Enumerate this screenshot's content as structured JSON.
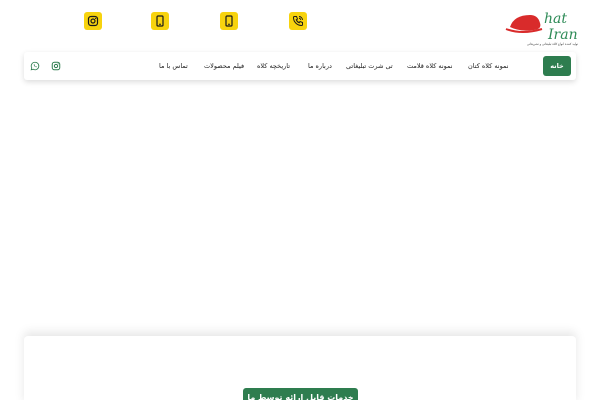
{
  "colors": {
    "brand_green": "#2e7d4f",
    "icon_yellow": "#f7d30e",
    "icon_dark": "#1a1a1a",
    "logo_red": "#d92b2b",
    "logo_green": "#2e8b57"
  },
  "header": {
    "logo_text": "hat iran",
    "logo_tagline": "تولید کننده انواع کلاه تبلیغاتی و تشریفاتی",
    "contact_icons": [
      "instagram-icon",
      "mobile-icon",
      "mobile-icon",
      "phone-icon"
    ]
  },
  "nav": {
    "home": "خانه",
    "items": [
      "نمونه کلاه کتان",
      "نمونه کلاه قلامت",
      "تی شرت تبلیغاتی",
      "درباره ما",
      "تاریخچه کلاه",
      "فیلم محصولات",
      "تماس با ما"
    ],
    "social_icons": [
      "instagram-icon",
      "whatsapp-icon"
    ]
  },
  "cta": {
    "label": "خدمات قابل ارائه توسط ما"
  }
}
